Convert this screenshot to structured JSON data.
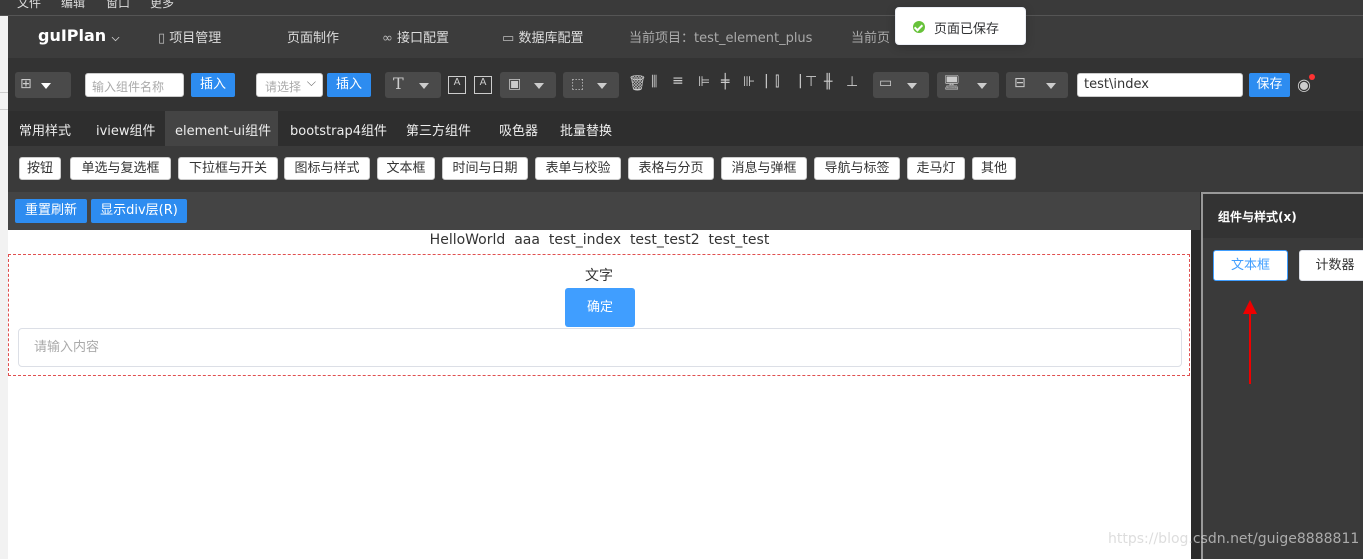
{
  "os_menu": [
    "文件",
    "编辑",
    "窗口",
    "更多"
  ],
  "nav": {
    "logo": "guIPlan",
    "items": [
      "项目管理",
      "页面制作",
      "接口配置",
      "数据库配置"
    ],
    "current_project": "当前项目：test_element_plus",
    "current_page": "当前页"
  },
  "toast": {
    "message": "页面已保存",
    "color": "#67c23a"
  },
  "toolbar": {
    "component_search_placeholder": "输入组件名称",
    "insert_label": "插入",
    "select_placeholder": "请选择",
    "insert2_label": "插入",
    "path_value": "test\\index",
    "save_label": "保存"
  },
  "tabs": [
    "常用样式",
    "iview组件",
    "element-ui组件",
    "bootstrap4组件",
    "第三方组件",
    "吸色器",
    "批量替换"
  ],
  "active_tab": "element-ui组件",
  "categories": [
    "按钮",
    "单选与复选框",
    "下拉框与开关",
    "图标与样式",
    "文本框",
    "时间与日期",
    "表单与校验",
    "表格与分页",
    "消息与弹框",
    "导航与标签",
    "走马灯",
    "其他"
  ],
  "actions": {
    "reset_label": "重置刷新",
    "show_div_label": "显示div层(R)"
  },
  "canvas": {
    "pages": [
      "HelloWorld",
      "aaa",
      "test_index",
      "test_test2",
      "test_test"
    ],
    "text_label": "文字",
    "confirm_label": "确定",
    "input_placeholder": "请输入内容"
  },
  "right_panel": {
    "title": "组件与样式(x)",
    "buttons": [
      "文本框",
      "计数器"
    ]
  },
  "watermark": "https://blog.csdn.net/guige8888811",
  "colors": {
    "primary": "#2d8cf0",
    "element_primary": "#409eff",
    "annotation": "#e00000"
  }
}
